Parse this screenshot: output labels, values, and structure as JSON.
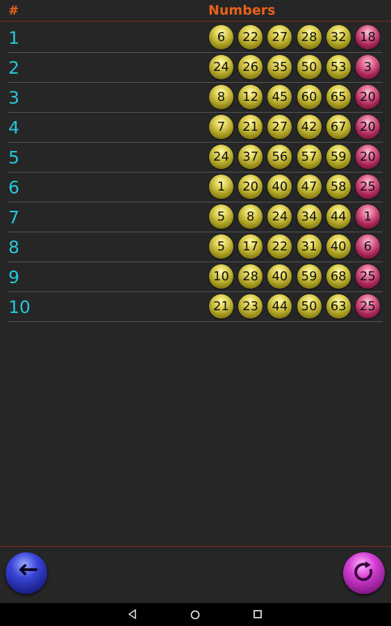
{
  "header": {
    "index_label": "#",
    "numbers_label": "Numbers"
  },
  "rows": [
    {
      "index": "1",
      "numbers": [
        "6",
        "22",
        "27",
        "28",
        "32"
      ],
      "bonus": "18"
    },
    {
      "index": "2",
      "numbers": [
        "24",
        "26",
        "35",
        "50",
        "53"
      ],
      "bonus": "3"
    },
    {
      "index": "3",
      "numbers": [
        "8",
        "12",
        "45",
        "60",
        "65"
      ],
      "bonus": "20"
    },
    {
      "index": "4",
      "numbers": [
        "7",
        "21",
        "27",
        "42",
        "67"
      ],
      "bonus": "20"
    },
    {
      "index": "5",
      "numbers": [
        "24",
        "37",
        "56",
        "57",
        "59"
      ],
      "bonus": "20"
    },
    {
      "index": "6",
      "numbers": [
        "1",
        "20",
        "40",
        "47",
        "58"
      ],
      "bonus": "25"
    },
    {
      "index": "7",
      "numbers": [
        "5",
        "8",
        "24",
        "34",
        "44"
      ],
      "bonus": "1"
    },
    {
      "index": "8",
      "numbers": [
        "5",
        "17",
        "22",
        "31",
        "40"
      ],
      "bonus": "6"
    },
    {
      "index": "9",
      "numbers": [
        "10",
        "28",
        "40",
        "59",
        "68"
      ],
      "bonus": "25"
    },
    {
      "index": "10",
      "numbers": [
        "21",
        "23",
        "44",
        "50",
        "63"
      ],
      "bonus": "25"
    }
  ],
  "footer": {
    "back_icon": "arrow-left-icon",
    "refresh_icon": "refresh-icon"
  },
  "navbar": {
    "icons": [
      "nav-back-icon",
      "nav-home-icon",
      "nav-recents-icon"
    ]
  },
  "colors": {
    "header_text": "#e8621a",
    "index_text": "#26c6da",
    "main_ball": "#c9bd3a",
    "bonus_ball": "#c2356d"
  }
}
